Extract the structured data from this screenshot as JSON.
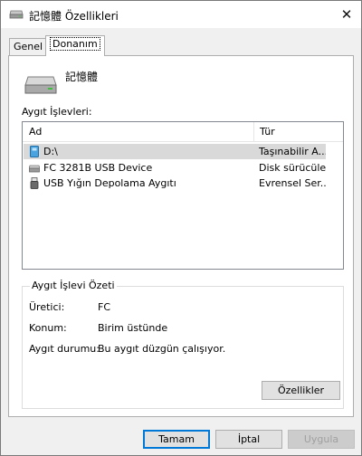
{
  "window": {
    "title": "記憶體 Özellikleri",
    "close_glyph": "✕"
  },
  "tabs": [
    {
      "label": "Genel",
      "active": false
    },
    {
      "label": "Donanım",
      "active": true
    }
  ],
  "device": {
    "name": "記憶體",
    "icon": "drive-icon"
  },
  "functions": {
    "label": "Aygıt İşlevleri:",
    "columns": [
      "Ad",
      "Tür"
    ],
    "rows": [
      {
        "name": "D:\\",
        "type": "Taşınabilir A...",
        "icon": "removable-drive-icon",
        "selected": true
      },
      {
        "name": "FC 3281B USB Device",
        "type": "Disk sürücüleri",
        "icon": "disk-drive-icon",
        "selected": false
      },
      {
        "name": "USB Yığın Depolama Aygıtı",
        "type": "Evrensel Ser...",
        "icon": "usb-icon",
        "selected": false
      }
    ]
  },
  "summary": {
    "title": "Aygıt İşlevi Özeti",
    "manufacturer_label": "Üretici:",
    "manufacturer_value": "FC",
    "location_label": "Konum:",
    "location_value": "Birim üstünde",
    "status_label": "Aygıt durumu:",
    "status_value": "Bu aygıt düzgün çalışıyor.",
    "properties_button": "Özellikler"
  },
  "buttons": {
    "ok": "Tamam",
    "cancel": "İptal",
    "apply": "Uygula"
  },
  "colors": {
    "selection": "#d9d9d9",
    "focus_border": "#0078d7"
  }
}
